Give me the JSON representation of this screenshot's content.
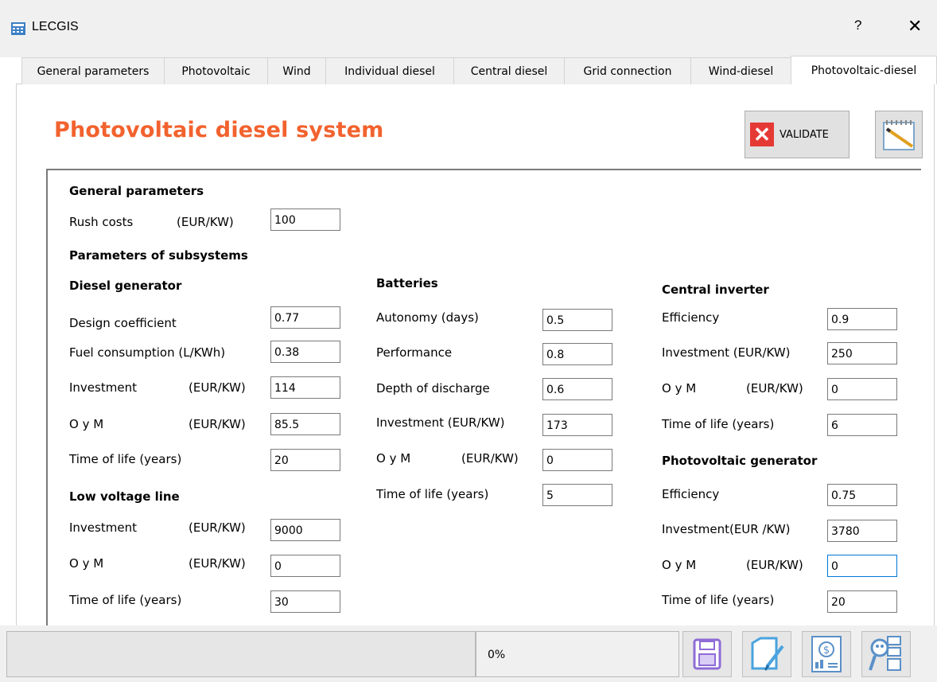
{
  "window": {
    "title": "LECGIS",
    "help": "?",
    "close": "✕"
  },
  "tabs": [
    {
      "label": "General parameters"
    },
    {
      "label": "Photovoltaic"
    },
    {
      "label": "Wind"
    },
    {
      "label": "Individual diesel"
    },
    {
      "label": "Central diesel"
    },
    {
      "label": "Grid connection"
    },
    {
      "label": "Wind-diesel"
    },
    {
      "label": "Photovoltaic-diesel",
      "active": true
    }
  ],
  "page": {
    "heading": "Photovoltaic diesel system",
    "heading_color": "#f2622e",
    "validate_label": "VALIDATE"
  },
  "general": {
    "title": "General parameters",
    "rush_label": "Rush costs",
    "rush_unit": "(EUR/KW)",
    "rush_value": "100"
  },
  "subsystems": {
    "title": "Parameters of subsystems"
  },
  "diesel": {
    "title": "Diesel generator",
    "design_label": "Design coefficient",
    "design_value": "0.77",
    "fuel_label": "Fuel consumption (L/KWh)",
    "fuel_value": "0.38",
    "inv_label": "Investment",
    "inv_unit": "(EUR/KW)",
    "inv_value": "114",
    "om_label": "O y M",
    "om_unit": "(EUR/KW)",
    "om_value": "85.5",
    "life_label": "Time of life (years)",
    "life_value": "20"
  },
  "lowvoltage": {
    "title": "Low voltage line",
    "inv_label": "Investment",
    "inv_unit": "(EUR/KW)",
    "inv_value": "9000",
    "om_label": "O y M",
    "om_unit": "(EUR/KW)",
    "om_value": "0",
    "life_label": "Time of life (years)",
    "life_value": "30"
  },
  "batteries": {
    "title": "Batteries",
    "autonomy_label": "Autonomy (days)",
    "autonomy_value": "0.5",
    "perf_label": "Performance",
    "perf_value": "0.8",
    "dod_label": "Depth of discharge",
    "dod_value": "0.6",
    "inv_label": "Investment (EUR/KW)",
    "inv_value": "173",
    "om_label": "O y M",
    "om_unit": "(EUR/KW)",
    "om_value": "0",
    "life_label": "Time of life (years)",
    "life_value": "5"
  },
  "inverter": {
    "title": "Central inverter",
    "eff_label": "Efficiency",
    "eff_value": "0.9",
    "inv_label": "Investment (EUR/KW)",
    "inv_value": "250",
    "om_label": "O y M",
    "om_unit": "(EUR/KW)",
    "om_value": "0",
    "life_label": "Time of life (years)",
    "life_value": "6"
  },
  "pvgen": {
    "title": "Photovoltaic generator",
    "eff_label": "Efficiency",
    "eff_value": "0.75",
    "inv_label": "Investment(EUR /KW)",
    "inv_value": "3780",
    "om_label": "O y M",
    "om_unit": "(EUR/KW)",
    "om_value": "0",
    "life_label": "Time of life (years)",
    "life_value": "20"
  },
  "status": {
    "progress_text": "0%"
  },
  "icons": [
    "save-icon",
    "edit-document-icon",
    "cost-analysis-icon",
    "search-report-icon"
  ]
}
